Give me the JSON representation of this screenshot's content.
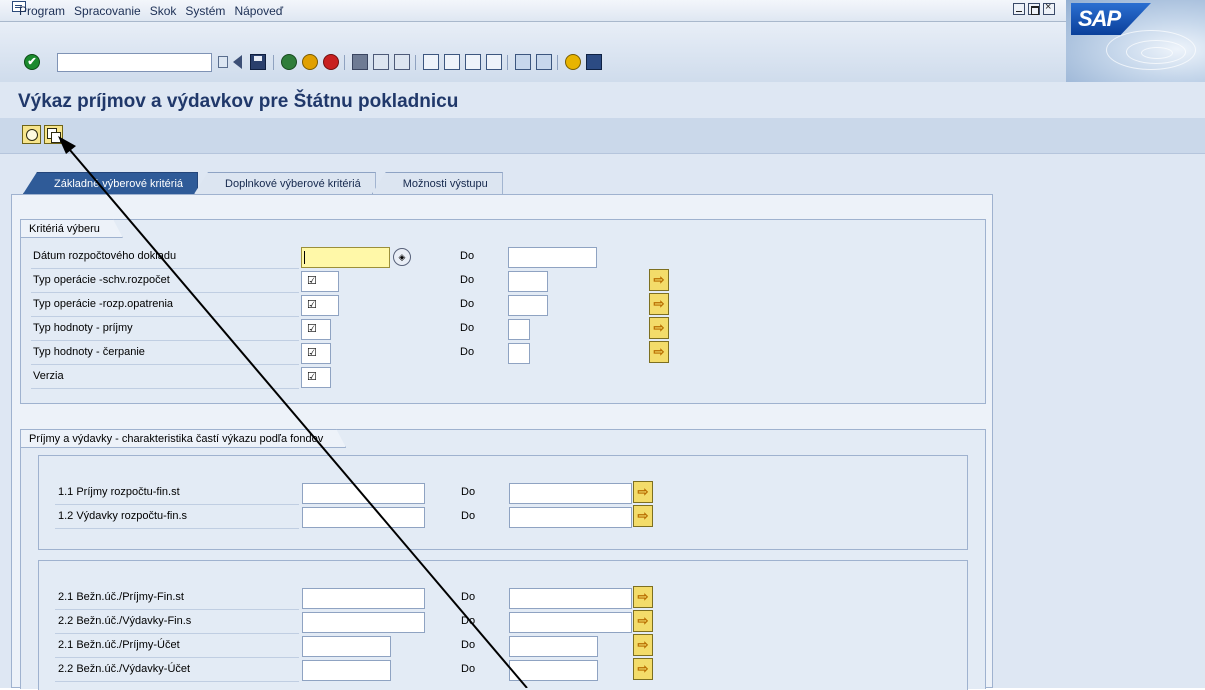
{
  "menu": [
    {
      "label": "Program"
    },
    {
      "label": "Spracovanie"
    },
    {
      "label": "Skok"
    },
    {
      "label": "Systém"
    },
    {
      "label": "Nápoveď"
    }
  ],
  "logo_text": "SAP",
  "title": "Výkaz príjmov a výdavkov pre Štátnu pokladnicu",
  "tabs": [
    {
      "label": "Základné výberové kritériá"
    },
    {
      "label": "Doplnkové výberové kritériá"
    },
    {
      "label": "Možnosti výstupu"
    }
  ],
  "groups": {
    "selection": {
      "title": "Kritériá výberu",
      "to_label": "Do",
      "rows": [
        {
          "label": "Dátum rozpočtového dokladu"
        },
        {
          "label": "Typ operácie -schv.rozpočet",
          "check": "☑"
        },
        {
          "label": "Typ operácie -rozp.opatrenia",
          "check": "☑"
        },
        {
          "label": "Typ hodnoty - príjmy",
          "check": "☑"
        },
        {
          "label": "Typ hodnoty - čerpanie",
          "check": "☑"
        },
        {
          "label": "Verzia",
          "check": "☑"
        }
      ]
    },
    "funds": {
      "title": "Príjmy a výdavky - charakteristika častí výkazu podľa fondov",
      "to_label": "Do",
      "box1": [
        {
          "label": "1.1 Príjmy rozpočtu-fin.st"
        },
        {
          "label": "1.2 Výdavky rozpočtu-fin.s"
        }
      ],
      "box2": [
        {
          "label": "2.1 Bežn.úč./Príjmy-Fin.st"
        },
        {
          "label": "2.2 Bežn.úč./Výdavky-Fin.s"
        },
        {
          "label": "2.1 Bežn.úč./Príjmy-Účet"
        },
        {
          "label": "2.2 Bežn.úč./Výdavky-Účet"
        }
      ]
    }
  },
  "colors": {
    "title": "#20386a",
    "active_tab": "#2f5b98",
    "required_field": "#fff8a8",
    "multiple_selection_button": "#f3dc6a"
  },
  "icons": {
    "ok": "checkmark-icon",
    "multiple_selection": "arrow-right-icon",
    "execute": "execute-icon",
    "variant": "get-variant-icon"
  }
}
